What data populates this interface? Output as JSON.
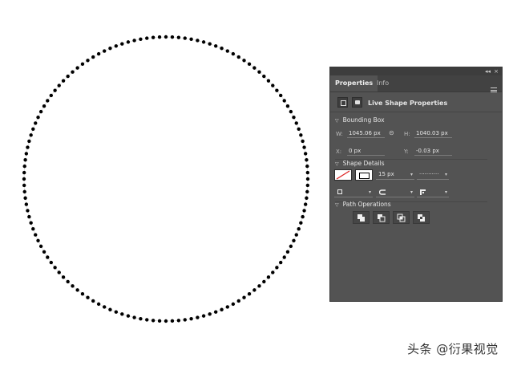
{
  "panel": {
    "collapse_label": "◂◂",
    "close_label": "×",
    "tabs": [
      {
        "label": "Properties",
        "active": true
      },
      {
        "label": "Info",
        "active": false
      }
    ],
    "header_title": "Live Shape Properties",
    "bounding_box": {
      "title": "Bounding Box",
      "w_label": "W:",
      "w_value": "1045.06 px",
      "h_label": "H:",
      "h_value": "1040.03 px",
      "x_label": "X:",
      "x_value": "0 px",
      "y_label": "Y:",
      "y_value": "-0.03 px"
    },
    "shape_details": {
      "title": "Shape Details",
      "stroke_width": "15 px",
      "stroke_style": "···········"
    },
    "path_operations": {
      "title": "Path Operations"
    }
  },
  "colors": {
    "panel_bg": "#535353",
    "tab_bar_bg": "#424242",
    "dots": "#000000"
  },
  "watermark": "头条 @衍果视觉"
}
